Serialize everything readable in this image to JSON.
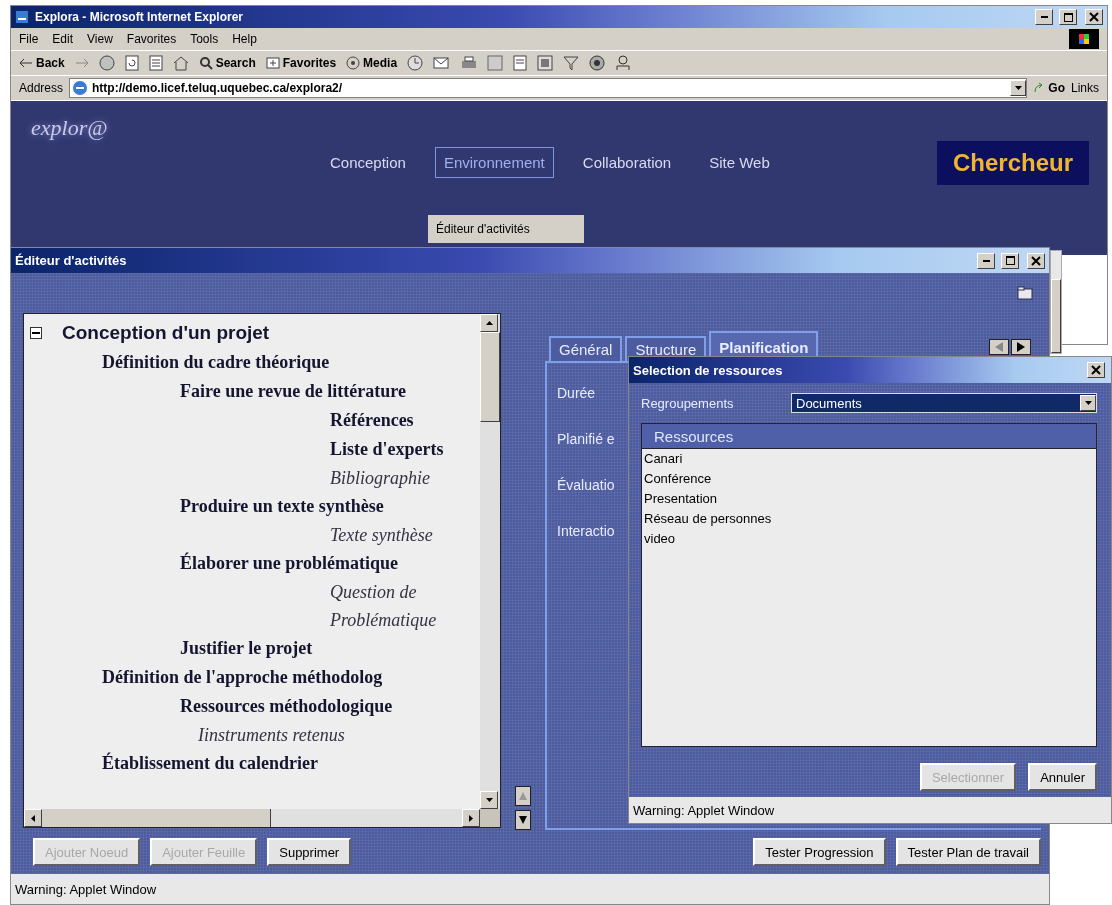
{
  "browser": {
    "title": "Explora - Microsoft Internet Explorer",
    "menu": [
      "File",
      "Edit",
      "View",
      "Favorites",
      "Tools",
      "Help"
    ],
    "toolbar": {
      "back": "Back",
      "search": "Search",
      "favorites": "Favorites",
      "media": "Media"
    },
    "address": {
      "label": "Address",
      "value": "http://demo.licef.teluq.uquebec.ca/explora2/",
      "go": "Go",
      "links": "Links"
    },
    "site": {
      "logo": "explor@",
      "nav": [
        {
          "label": "Conception",
          "selected": false
        },
        {
          "label": "Environnement",
          "selected": true
        },
        {
          "label": "Collaboration",
          "selected": false
        },
        {
          "label": "Site Web",
          "selected": false
        }
      ],
      "role": "Chercheur",
      "dropdown": [
        "Éditeur d'activités"
      ]
    }
  },
  "applet": {
    "title": "Éditeur d'activités",
    "tree": [
      {
        "label": "Conception d'un projet",
        "kind": "root",
        "expanded": true,
        "children": [
          {
            "label": "Définition du cadre théorique",
            "kind": "node",
            "children": [
              {
                "label": "Faire une revue de littérature",
                "kind": "node",
                "children": [
                  {
                    "label": "Références",
                    "kind": "node"
                  },
                  {
                    "label": "Liste d'experts",
                    "kind": "node"
                  },
                  {
                    "label": "Bibliographie",
                    "kind": "leaf"
                  }
                ]
              },
              {
                "label": "Produire un texte synthèse",
                "kind": "node",
                "children": [
                  {
                    "label": "Texte synthèse",
                    "kind": "leaf"
                  }
                ]
              },
              {
                "label": "Élaborer une problématique",
                "kind": "node",
                "children": [
                  {
                    "label": "Question de Problématique",
                    "kind": "leaf"
                  }
                ]
              },
              {
                "label": "Justifier le projet",
                "kind": "node"
              }
            ]
          },
          {
            "label": "Définition de l'approche méthodolog",
            "kind": "node",
            "children": [
              {
                "label": "Ressources méthodologique",
                "kind": "node"
              },
              {
                "label": "Iinstruments retenus",
                "kind": "leaf"
              }
            ]
          },
          {
            "label": "Établissement du calendrier",
            "kind": "node"
          }
        ]
      }
    ],
    "tabs": [
      {
        "label": "Général",
        "selected": false
      },
      {
        "label": "Structure",
        "selected": false
      },
      {
        "label": "Planification",
        "selected": true
      }
    ],
    "fields": [
      "Durée",
      "Planifié e",
      "Évaluatio",
      "Interactio"
    ],
    "left_buttons": [
      {
        "label": "Ajouter Noeud",
        "disabled": true
      },
      {
        "label": "Ajouter Feuille",
        "disabled": true
      },
      {
        "label": "Supprimer",
        "disabled": false
      }
    ],
    "right_buttons": [
      {
        "label": "Tester Progression",
        "disabled": false
      },
      {
        "label": "Tester Plan de travail",
        "disabled": false
      }
    ],
    "status": "Warning: Applet Window"
  },
  "dialog": {
    "title": "Selection de ressources",
    "group_label": "Regroupements",
    "group_value": "Documents",
    "list_header": "Ressources",
    "items": [
      "Canari",
      "Conférence",
      "Presentation",
      "Réseau de personnes",
      "video"
    ],
    "buttons": [
      {
        "label": "Selectionner",
        "disabled": true
      },
      {
        "label": "Annuler",
        "disabled": false
      }
    ],
    "status": "Warning: Applet Window"
  }
}
